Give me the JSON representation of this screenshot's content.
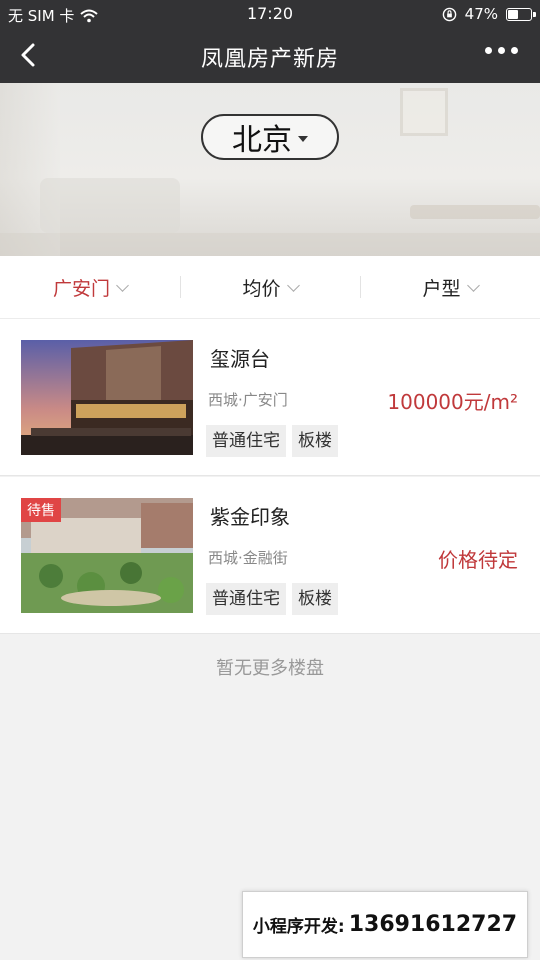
{
  "status_bar": {
    "carrier": "无 SIM 卡",
    "time": "17:20",
    "battery_percent": "47%",
    "battery_level": 0.47
  },
  "nav": {
    "title": "凤凰房产新房"
  },
  "hero": {
    "city": "北京"
  },
  "filters": [
    {
      "label": "广安门",
      "active": true,
      "color": "#c0393b"
    },
    {
      "label": "均价",
      "active": false
    },
    {
      "label": "户型",
      "active": false
    }
  ],
  "listings": [
    {
      "name": "玺源台",
      "location": "西城·广安门",
      "price": "100000元/m²",
      "tags": [
        "普通住宅",
        "板楼"
      ],
      "badge": ""
    },
    {
      "name": "紫金印象",
      "location": "西城·金融街",
      "price": "价格待定",
      "tags": [
        "普通住宅",
        "板楼"
      ],
      "badge": "待售"
    }
  ],
  "no_more_text": "暂无更多楼盘",
  "footer": {
    "label": "小程序开发:",
    "phone": "13691612727"
  },
  "colors": {
    "nav_bg": "#333335",
    "price": "#c0393b",
    "badge": "#e04545"
  }
}
